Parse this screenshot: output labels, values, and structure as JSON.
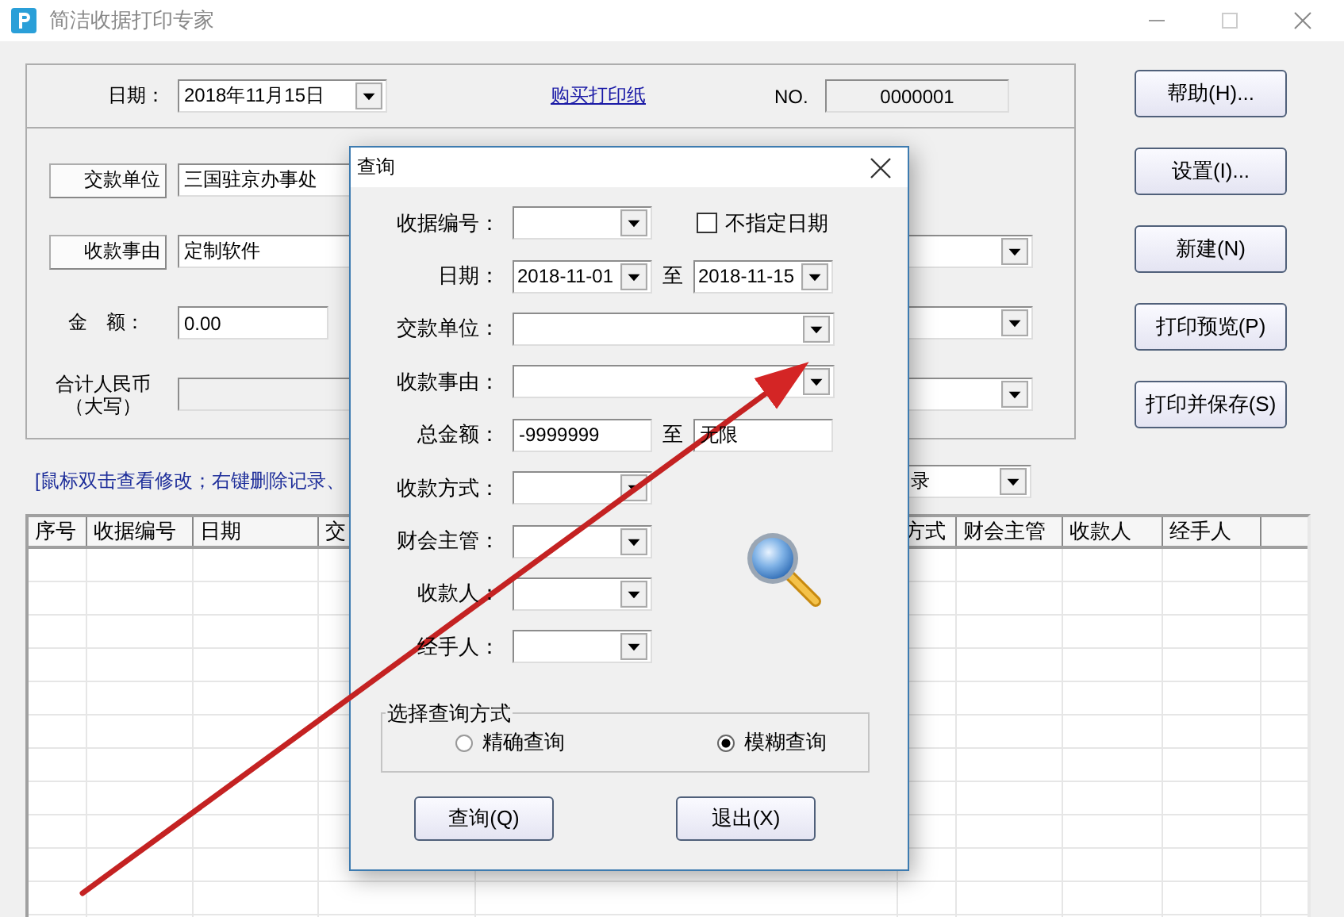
{
  "window": {
    "title": "简洁收据打印专家"
  },
  "form": {
    "date_label": "日期：",
    "date_value": "2018年11月15日",
    "buy_link": "购买打印纸",
    "no_label": "NO.",
    "no_value": "0000001",
    "payer_button": "交款单位",
    "payer_value": "三国驻京办事处",
    "reason_button": "收款事由",
    "reason_value": "定制软件",
    "amount_label": "金　额：",
    "amount_value": "0.00",
    "total_label": [
      "合计人民币",
      "（大写）"
    ]
  },
  "side_buttons": [
    "帮助(H)...",
    "设置(I)...",
    "新建(N)",
    "打印预览(P)",
    "打印并保存(S)"
  ],
  "hint": "[鼠标双击查看修改；右键删除记录、",
  "filter_value": "录",
  "table": {
    "columns": [
      "序号",
      "收据编号",
      "日期",
      "交",
      "方式",
      "财会主管",
      "收款人",
      "经手人"
    ]
  },
  "dialog": {
    "title": "查询",
    "receipt_no": {
      "label": "收据编号："
    },
    "no_date": {
      "label": "不指定日期",
      "checked": false
    },
    "date": {
      "label": "日期：",
      "from": "2018-11-01",
      "to_label": "至",
      "to": "2018-11-15"
    },
    "payer": {
      "label": "交款单位："
    },
    "reason": {
      "label": "收款事由："
    },
    "amount": {
      "label": "总金额：",
      "from": "-9999999",
      "to_label": "至",
      "to": "无限"
    },
    "people": [
      {
        "label": "收款方式："
      },
      {
        "label": "财会主管："
      },
      {
        "label": "收款人："
      },
      {
        "label": "经手人："
      }
    ],
    "mode": {
      "legend": "选择查询方式",
      "options": [
        {
          "label": "精确查询",
          "selected": false
        },
        {
          "label": "模糊查询",
          "selected": true
        }
      ]
    },
    "buttons": [
      "查询(Q)",
      "退出(X)"
    ]
  }
}
